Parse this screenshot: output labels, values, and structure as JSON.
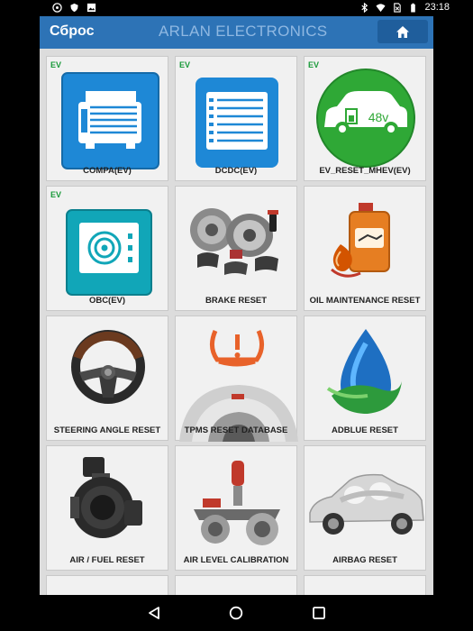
{
  "status_bar": {
    "time": "23:18"
  },
  "header": {
    "title": "Сброс",
    "brand": "ARLAN ELECTRONICS"
  },
  "tiles": [
    {
      "label": "COMPA(EV)",
      "ev": "EV"
    },
    {
      "label": "DCDC(EV)",
      "ev": "EV"
    },
    {
      "label": "EV_RESET_MHEV(EV)",
      "ev": "EV",
      "badge": "48v"
    },
    {
      "label": "OBC(EV)",
      "ev": "EV"
    },
    {
      "label": "BRAKE RESET",
      "ev": ""
    },
    {
      "label": "OIL MAINTENANCE RESET",
      "ev": ""
    },
    {
      "label": "STEERING ANGLE RESET",
      "ev": ""
    },
    {
      "label": "TPMS RESET DATABASE",
      "ev": ""
    },
    {
      "label": "ADBLUE RESET",
      "ev": ""
    },
    {
      "label": "AIR / FUEL RESET",
      "ev": ""
    },
    {
      "label": "AIR LEVEL CALIBRATION",
      "ev": ""
    },
    {
      "label": "AIRBAG RESET",
      "ev": ""
    }
  ]
}
